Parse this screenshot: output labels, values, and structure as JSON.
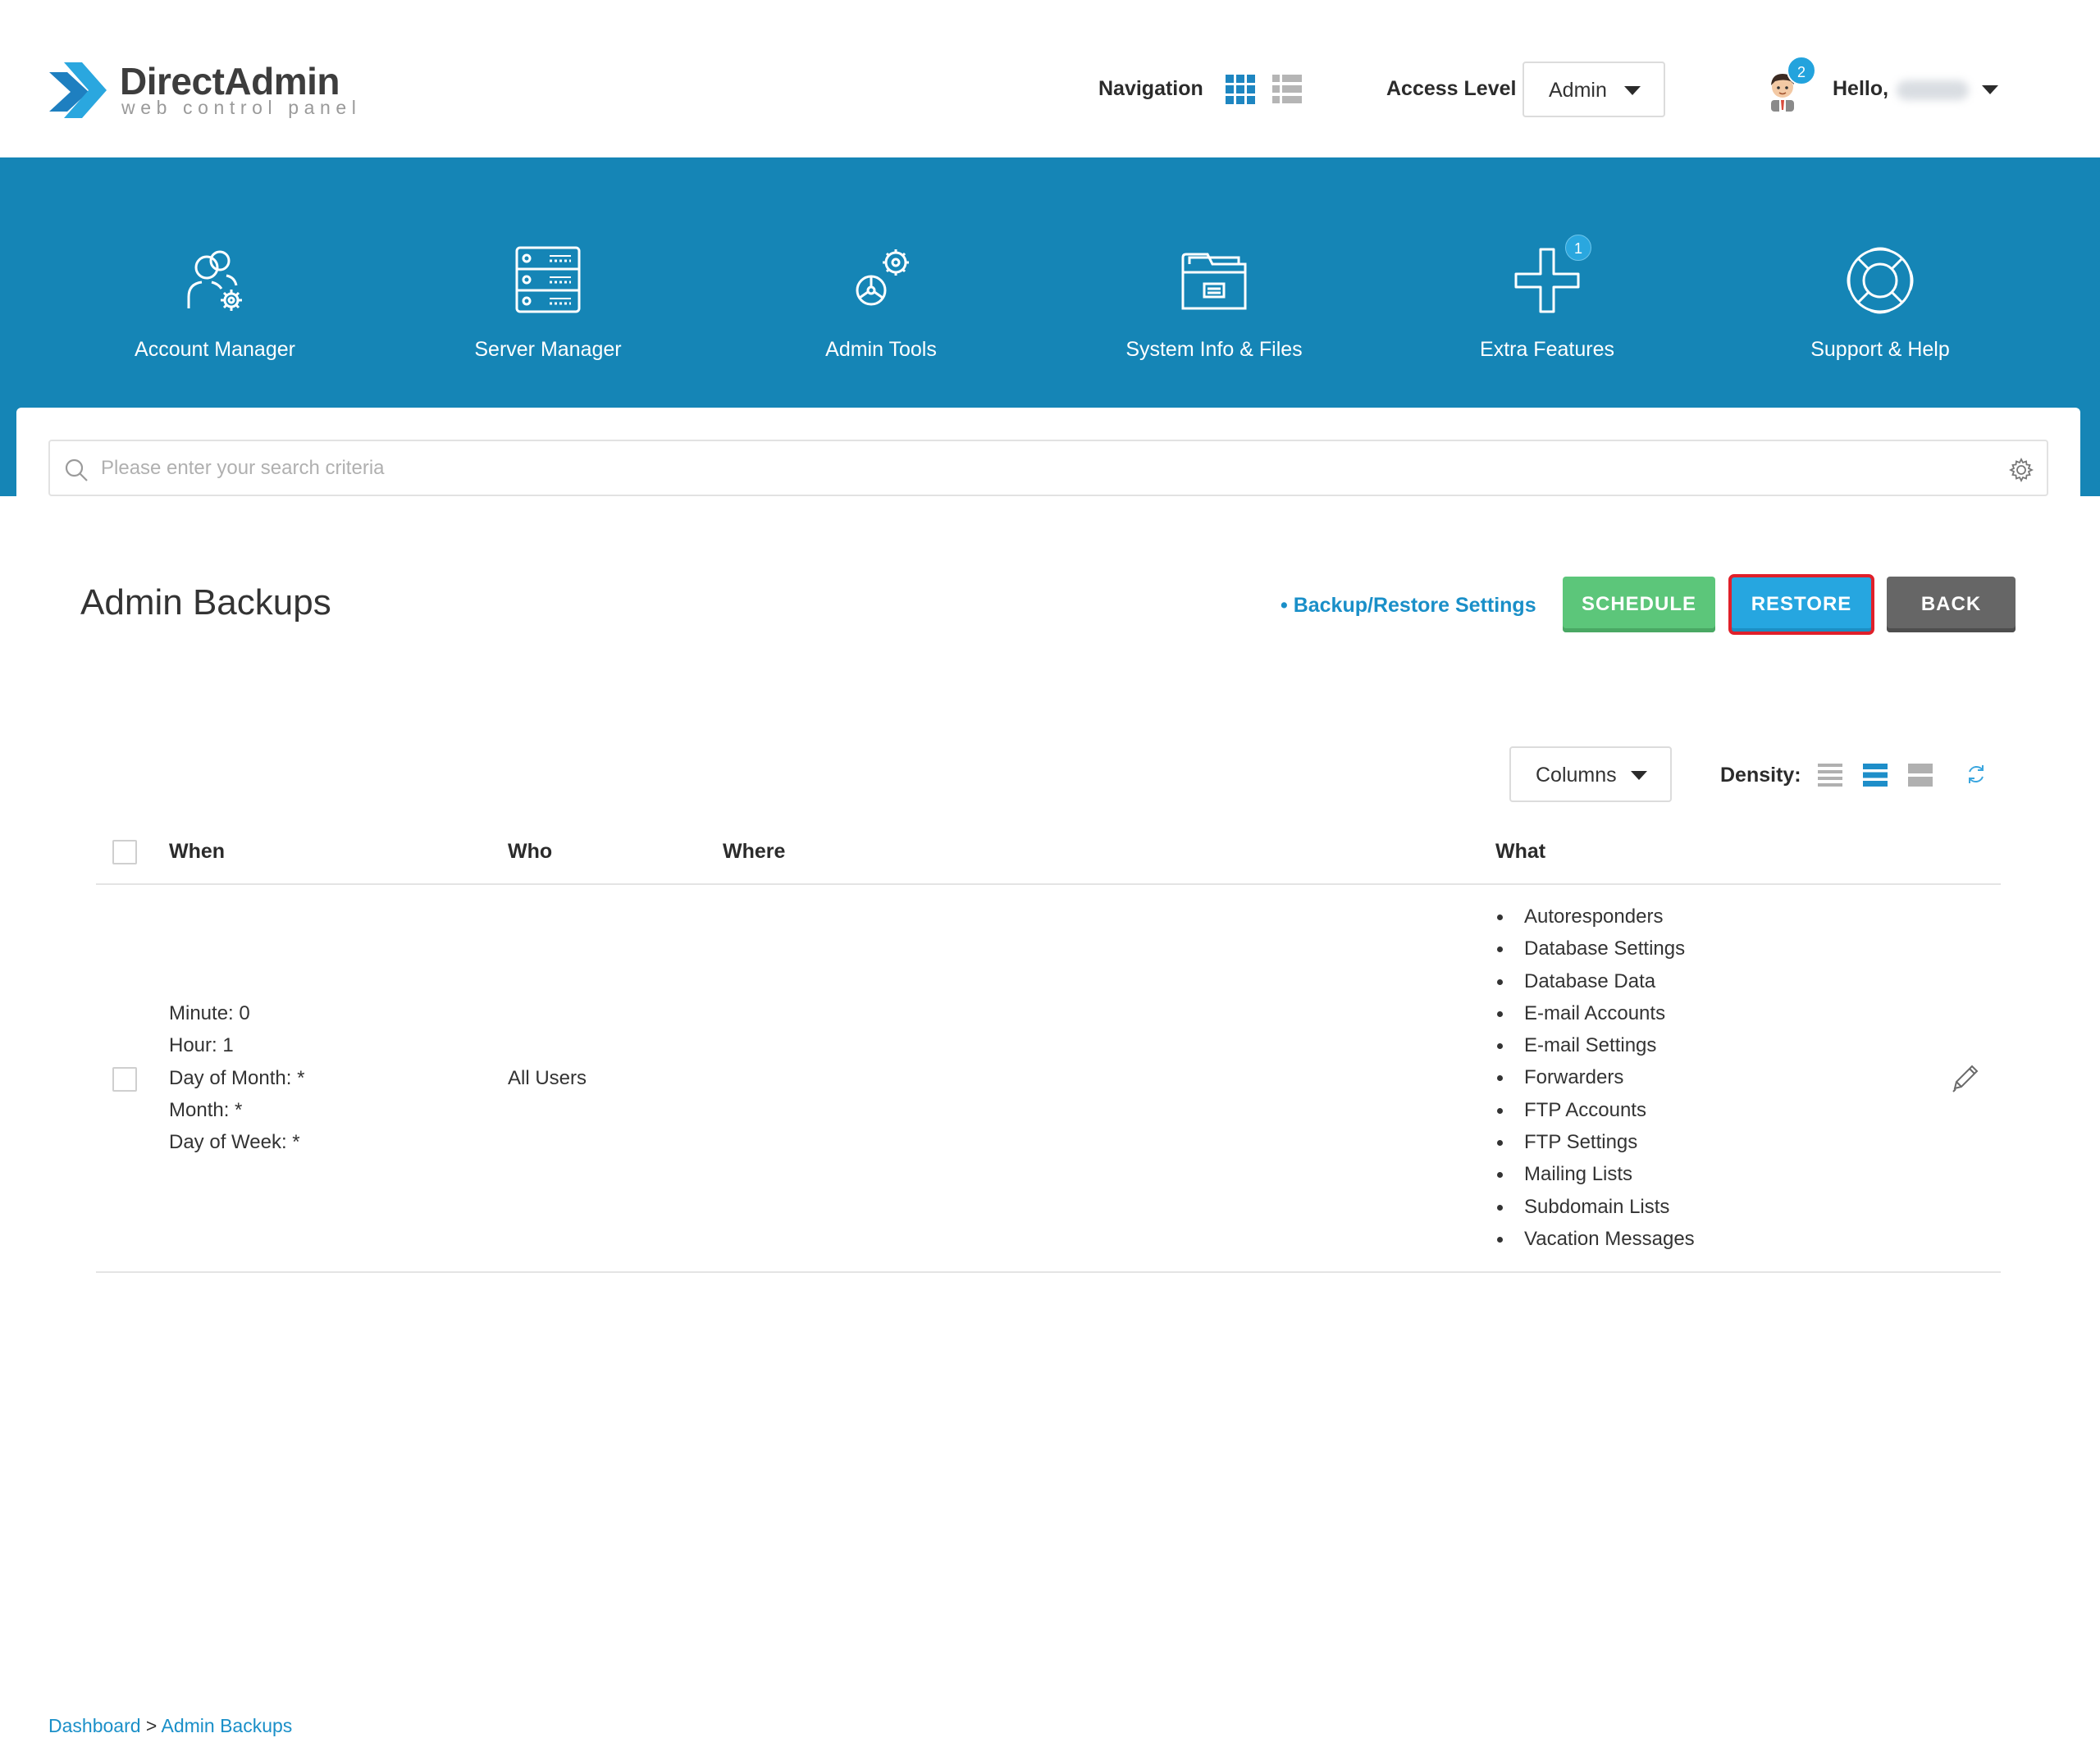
{
  "header": {
    "logo": {
      "title": "DirectAdmin",
      "subtitle": "web control panel"
    },
    "navigation_label": "Navigation",
    "access_level_label": "Access Level",
    "access_level_value": "Admin",
    "notifications_count": "2",
    "greeting": "Hello,"
  },
  "main_nav": {
    "items": [
      {
        "label": "Account Manager",
        "icon": "users-gear-icon"
      },
      {
        "label": "Server Manager",
        "icon": "server-rack-icon"
      },
      {
        "label": "Admin Tools",
        "icon": "gears-icon"
      },
      {
        "label": "System Info & Files",
        "icon": "folder-icon"
      },
      {
        "label": "Extra Features",
        "icon": "plus-icon",
        "badge": "1"
      },
      {
        "label": "Support & Help",
        "icon": "lifebuoy-icon"
      }
    ]
  },
  "search": {
    "placeholder": "Please enter your search criteria",
    "value": ""
  },
  "page": {
    "title": "Admin Backups",
    "settings_link": "• Backup/Restore Settings",
    "buttons": {
      "schedule": "SCHEDULE",
      "restore": "RESTORE",
      "back": "BACK"
    }
  },
  "table_controls": {
    "columns_label": "Columns",
    "density_label": "Density:",
    "density_selected": "medium"
  },
  "table": {
    "headers": {
      "when": "When",
      "who": "Who",
      "where": "Where",
      "what": "What"
    },
    "rows": [
      {
        "when": [
          "Minute: 0",
          "Hour: 1",
          "Day of Month: *",
          "Month: *",
          "Day of Week: *"
        ],
        "who": "All Users",
        "where": "",
        "what": [
          "Autoresponders",
          "Database Settings",
          "Database Data",
          "E-mail Accounts",
          "E-mail Settings",
          "Forwarders",
          "FTP Accounts",
          "FTP Settings",
          "Mailing Lists",
          "Subdomain Lists",
          "Vacation Messages"
        ]
      }
    ]
  },
  "breadcrumb": {
    "home": "Dashboard",
    "separator": ">",
    "current": "Admin Backups"
  },
  "colors": {
    "brand_blue": "#1585b6",
    "accent_blue": "#26a6e0",
    "schedule_green": "#5cc67a",
    "back_gray": "#666666",
    "highlight_red": "#e0202a"
  }
}
